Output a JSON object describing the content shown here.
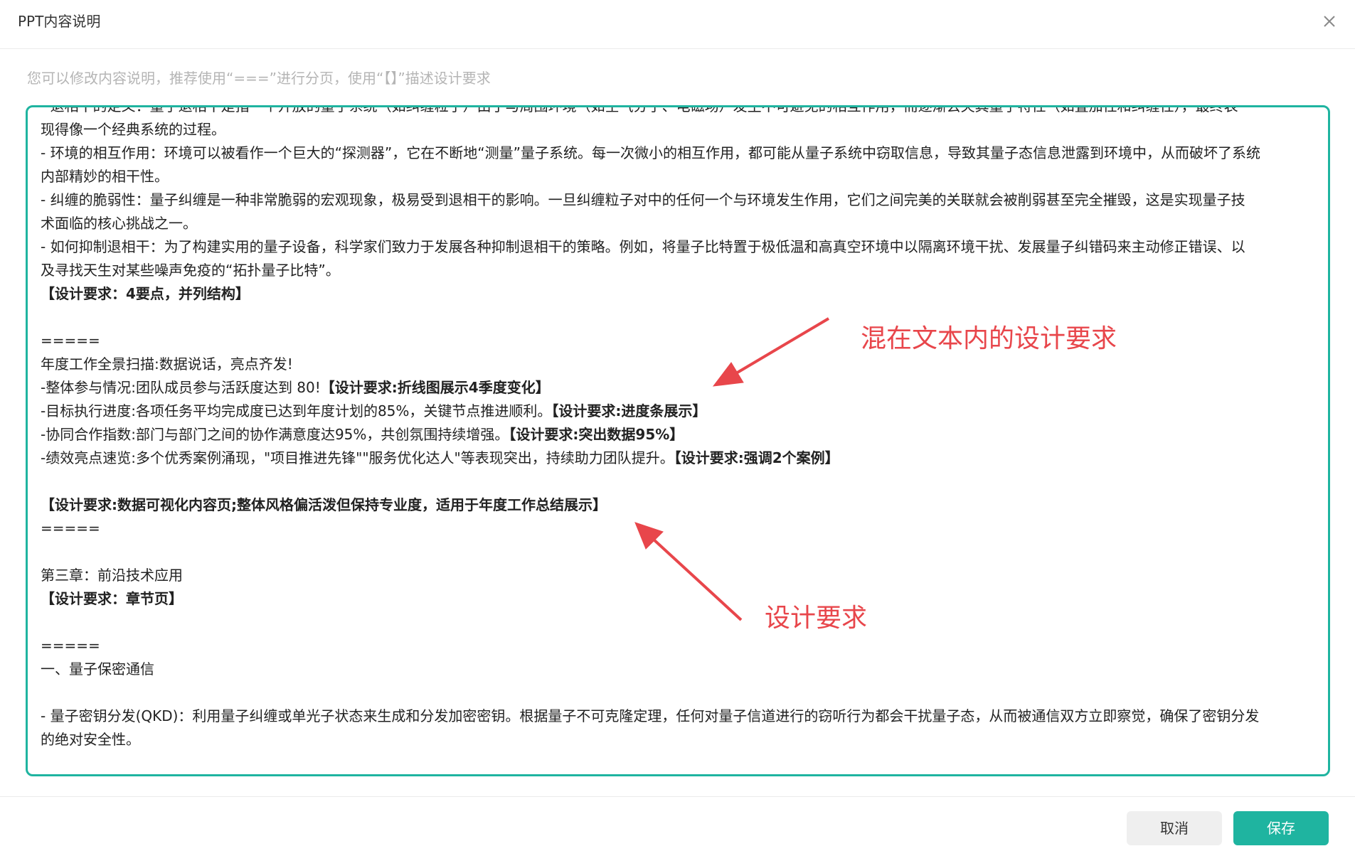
{
  "dialog": {
    "title": "PPT内容说明",
    "hint": "您可以修改内容说明，推荐使用“===”进行分页，使用“【】”描述设计要求",
    "close_icon": "close-icon"
  },
  "editor": {
    "lines": [
      {
        "parts": [
          {
            "t": "- 退相干的定义：量子退相干是指一个开放的量子系统（如纠缠粒子）由于与周围环境（如空气分子、电磁场）发生不可避免的相互作用，而逐渐丢失其量子特性（如叠加性和纠缠性），最终表"
          }
        ]
      },
      {
        "parts": [
          {
            "t": "现得像一个经典系统的过程。"
          }
        ]
      },
      {
        "parts": [
          {
            "t": "- 环境的相互作用：环境可以被看作一个巨大的“探测器”，它在不断地“测量”量子系统。每一次微小的相互作用，都可能从量子系统中窃取信息，导致其量子态信息泄露到环境中，从而破坏了系统"
          }
        ]
      },
      {
        "parts": [
          {
            "t": "内部精妙的相干性。"
          }
        ]
      },
      {
        "parts": [
          {
            "t": "- 纠缠的脆弱性：量子纠缠是一种非常脆弱的宏观现象，极易受到退相干的影响。一旦纠缠粒子对中的任何一个与环境发生作用，它们之间完美的关联就会被削弱甚至完全摧毁，这是实现量子技"
          }
        ]
      },
      {
        "parts": [
          {
            "t": "术面临的核心挑战之一。"
          }
        ]
      },
      {
        "parts": [
          {
            "t": "- 如何抑制退相干：为了构建实用的量子设备，科学家们致力于发展各种抑制退相干的策略。例如，将量子比特置于极低温和高真空环境中以隔离环境干扰、发展量子纠错码来主动修正错误、以"
          }
        ]
      },
      {
        "parts": [
          {
            "t": "及寻找天生对某些噪声免疫的“拓扑量子比特”。"
          }
        ]
      },
      {
        "parts": [
          {
            "t": "【设计要求：4要点，并列结构】",
            "b": true
          }
        ]
      },
      {
        "parts": []
      },
      {
        "parts": [
          {
            "t": "====="
          }
        ]
      },
      {
        "parts": [
          {
            "t": "年度工作全景扫描:数据说话，亮点齐发!"
          }
        ]
      },
      {
        "parts": [
          {
            "t": "-整体参与情况:团队成员参与活跃度达到 80!"
          },
          {
            "t": "【设计要求:折线图展示4季度变化】",
            "b": true
          }
        ]
      },
      {
        "parts": [
          {
            "t": "-目标执行进度:各项任务平均完成度已达到年度计划的85%，关键节点推进顺利。"
          },
          {
            "t": "【设计要求:进度条展示】",
            "b": true
          }
        ]
      },
      {
        "parts": [
          {
            "t": "-协同合作指数:部门与部门之间的协作满意度达95%，共创氛围持续增强。"
          },
          {
            "t": "【设计要求:突出数据95%】",
            "b": true
          }
        ]
      },
      {
        "parts": [
          {
            "t": "-绩效亮点速览:多个优秀案例涌现，\"项目推进先锋\"\"服务优化达人\"等表现突出，持续助力团队提升。"
          },
          {
            "t": "【设计要求:强调2个案例】",
            "b": true
          }
        ]
      },
      {
        "parts": []
      },
      {
        "parts": [
          {
            "t": "【设计要求:数据可视化内容页;整体风格偏活泼但保持专业度，适用于年度工作总结展示】",
            "b": true
          }
        ]
      },
      {
        "parts": [
          {
            "t": "====="
          }
        ]
      },
      {
        "parts": []
      },
      {
        "parts": [
          {
            "t": "第三章：前沿技术应用"
          }
        ]
      },
      {
        "parts": [
          {
            "t": "【设计要求：章节页】",
            "b": true
          }
        ]
      },
      {
        "parts": []
      },
      {
        "parts": [
          {
            "t": "====="
          }
        ]
      },
      {
        "parts": [
          {
            "t": "一、量子保密通信"
          }
        ]
      },
      {
        "parts": []
      },
      {
        "parts": [
          {
            "t": "- 量子密钥分发(QKD)：利用量子纠缠或单光子状态来生成和分发加密密钥。根据量子不可克隆定理，任何对量子信道进行的窃听行为都会干扰量子态，从而被通信双方立即察觉，确保了密钥分发"
          }
        ]
      },
      {
        "parts": [
          {
            "t": "的绝对安全性。"
          }
        ]
      }
    ]
  },
  "annotations": {
    "mixed": "混在文本内的设计要求",
    "design": "设计要求",
    "color": "#e8464b"
  },
  "footer": {
    "cancel_label": "取消",
    "save_label": "保存"
  },
  "colors": {
    "accent": "#1fb4a0"
  }
}
